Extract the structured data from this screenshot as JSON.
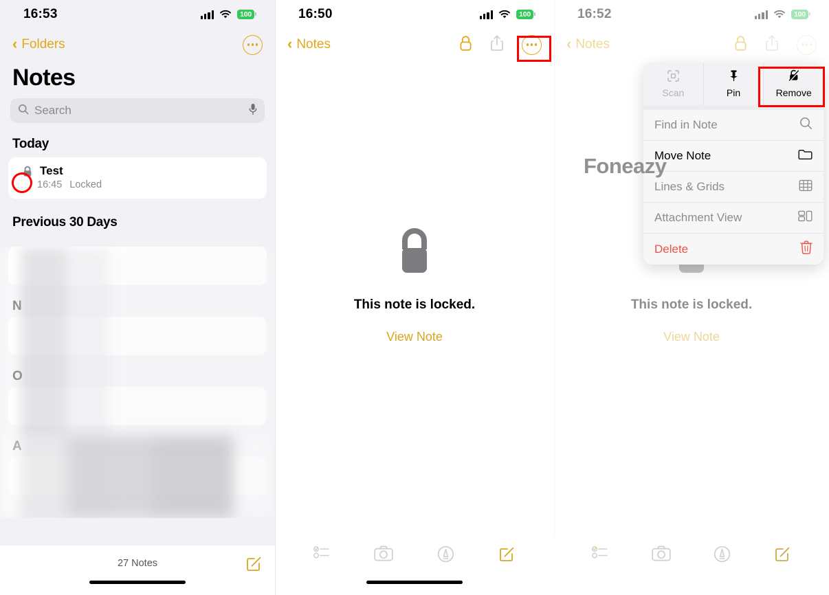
{
  "panels": [
    {
      "id": "notes-list",
      "status": {
        "time": "16:53",
        "battery": "100"
      },
      "nav": {
        "back_label": "Folders",
        "more_icon": "ellipsis-circle-icon"
      },
      "title": "Notes",
      "search": {
        "placeholder": "Search",
        "search_icon": "search-icon",
        "mic_icon": "microphone-icon"
      },
      "sections": [
        {
          "header": "Today",
          "notes": [
            {
              "title": "Test",
              "time": "16:45",
              "status": "Locked",
              "lock_icon": "lock-icon"
            }
          ]
        },
        {
          "header": "Previous 30 Days",
          "notes": []
        }
      ],
      "redacted_headers": [
        "N",
        "O",
        "A"
      ],
      "footer": {
        "count": "27 Notes",
        "compose_icon": "compose-icon"
      }
    },
    {
      "id": "locked-note",
      "status": {
        "time": "16:50",
        "battery": "100"
      },
      "nav": {
        "back_label": "Notes",
        "lock_icon": "lock-icon",
        "share_icon": "share-icon",
        "more_icon": "ellipsis-circle-icon"
      },
      "locked": {
        "icon": "lock-large-icon",
        "message": "This note is locked.",
        "action": "View Note"
      },
      "toolbar": [
        "checklist-icon",
        "camera-icon",
        "markup-pen-icon",
        "compose-icon"
      ]
    },
    {
      "id": "note-menu",
      "status": {
        "time": "16:52",
        "battery": "100"
      },
      "nav": {
        "back_label": "Notes",
        "lock_icon": "lock-icon",
        "share_icon": "share-icon",
        "more_icon": "ellipsis-circle-icon"
      },
      "locked": {
        "icon": "lock-large-icon",
        "message": "This note is locked.",
        "action": "View Note"
      },
      "menu": {
        "quick_actions": [
          {
            "label": "Scan",
            "icon": "scan-document-icon",
            "disabled": true
          },
          {
            "label": "Pin",
            "icon": "pin-icon",
            "disabled": false
          },
          {
            "label": "Remove",
            "icon": "unlock-icon",
            "disabled": false,
            "highlighted": true
          }
        ],
        "items": [
          {
            "label": "Find in Note",
            "icon": "search-icon",
            "state": "disabled"
          },
          {
            "label": "Move Note",
            "icon": "folder-icon",
            "state": "active"
          },
          {
            "label": "Lines & Grids",
            "icon": "grid-icon",
            "state": "disabled"
          },
          {
            "label": "Attachment View",
            "icon": "attachment-view-icon",
            "state": "disabled"
          },
          {
            "label": "Delete",
            "icon": "trash-icon",
            "state": "danger"
          }
        ]
      },
      "toolbar": [
        "checklist-icon",
        "camera-icon",
        "markup-pen-icon",
        "compose-icon"
      ]
    }
  ],
  "watermark": {
    "text": "Foneazy"
  },
  "colors": {
    "accent": "#e0a91c",
    "danger": "#e8554a",
    "highlight": "#ff0000",
    "battery": "#34c759"
  }
}
